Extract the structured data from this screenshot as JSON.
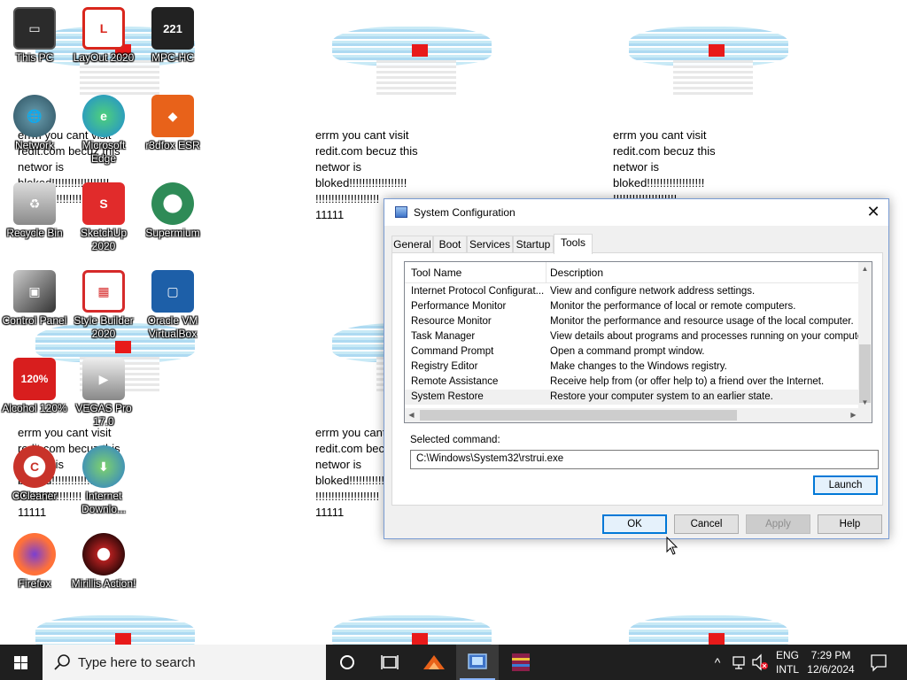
{
  "desktop": {
    "wallpaper_message": "errm you cant visit\nredit.com becuz this\nnetwor is\nbloked!!!!!!!!!!!!!!!!!!\n!!!!!!!!!!!!!!!!!!!!\n11111",
    "icons": [
      {
        "label": "This PC",
        "icon": "this-pc-icon",
        "color": "#2b2b2b"
      },
      {
        "label": "LayOut 2020",
        "icon": "layout-icon",
        "color": "#d9261c"
      },
      {
        "label": "MPC-HC",
        "icon": "mpc-hc-icon",
        "color": "#222222"
      },
      {
        "label": "Network",
        "icon": "network-icon",
        "color": "#3f6b7a"
      },
      {
        "label": "Microsoft Edge",
        "icon": "edge-icon",
        "color": "#1f8ad6"
      },
      {
        "label": "r3dfox ESR",
        "icon": "r3dfox-icon",
        "color": "#e8621a"
      },
      {
        "label": "Recycle Bin",
        "icon": "recycle-bin-icon",
        "color": "#7d7d7d"
      },
      {
        "label": "SketchUp 2020",
        "icon": "sketchup-icon",
        "color": "#e12b2b"
      },
      {
        "label": "Supermium",
        "icon": "supermium-icon",
        "color": "#2e8b57"
      },
      {
        "label": "Control Panel",
        "icon": "control-panel-icon",
        "color": "#3a3a3a"
      },
      {
        "label": "Style Builder 2020",
        "icon": "style-builder-icon",
        "color": "#d62a2a"
      },
      {
        "label": "Oracle VM VirtualBox",
        "icon": "virtualbox-icon",
        "color": "#1d5fa8"
      },
      {
        "label": "Alcohol 120%",
        "icon": "alcohol-icon",
        "color": "#d81e1e"
      },
      {
        "label": "VEGAS Pro 17.0",
        "icon": "vegas-icon",
        "color": "#9a9a9a"
      },
      {
        "label": "CCleaner",
        "icon": "ccleaner-icon",
        "color": "#c8332a"
      },
      {
        "label": "Internet Downlo...",
        "icon": "internet-download-icon",
        "color": "#2b7bd1"
      },
      {
        "label": "Firefox",
        "icon": "firefox-icon",
        "color": "#ff7139"
      },
      {
        "label": "Mirillis Action!",
        "icon": "mirillis-icon",
        "color": "#b01f1f"
      }
    ]
  },
  "dialog": {
    "title": "System Configuration",
    "close_glyph": "✕",
    "tabs": [
      "General",
      "Boot",
      "Services",
      "Startup",
      "Tools"
    ],
    "active_tab": "Tools",
    "list": {
      "columns": [
        "Tool Name",
        "Description"
      ],
      "rows": [
        {
          "name": "Internet Protocol Configurat...",
          "desc": "View and configure network address settings."
        },
        {
          "name": "Performance Monitor",
          "desc": "Monitor the performance of local or remote computers."
        },
        {
          "name": "Resource Monitor",
          "desc": "Monitor the performance and resource usage of the local computer."
        },
        {
          "name": "Task Manager",
          "desc": "View details about programs and processes running on your computer."
        },
        {
          "name": "Command Prompt",
          "desc": "Open a command prompt window."
        },
        {
          "name": "Registry Editor",
          "desc": "Make changes to the Windows registry."
        },
        {
          "name": "Remote Assistance",
          "desc": "Receive help from (or offer help to) a friend over the Internet."
        },
        {
          "name": "System Restore",
          "desc": "Restore your computer system to an earlier state."
        }
      ],
      "selected_row": "System Restore"
    },
    "selected_command_label": "Selected command:",
    "selected_command_value": "C:\\Windows\\System32\\rstrui.exe",
    "launch_label": "Launch",
    "ok_label": "OK",
    "cancel_label": "Cancel",
    "apply_label": "Apply",
    "help_label": "Help"
  },
  "taskbar": {
    "search_placeholder": "Type here to search",
    "lang_line1": "ENG",
    "lang_line2": "INTL",
    "time": "7:29 PM",
    "date": "12/6/2024",
    "chevron": "^"
  }
}
